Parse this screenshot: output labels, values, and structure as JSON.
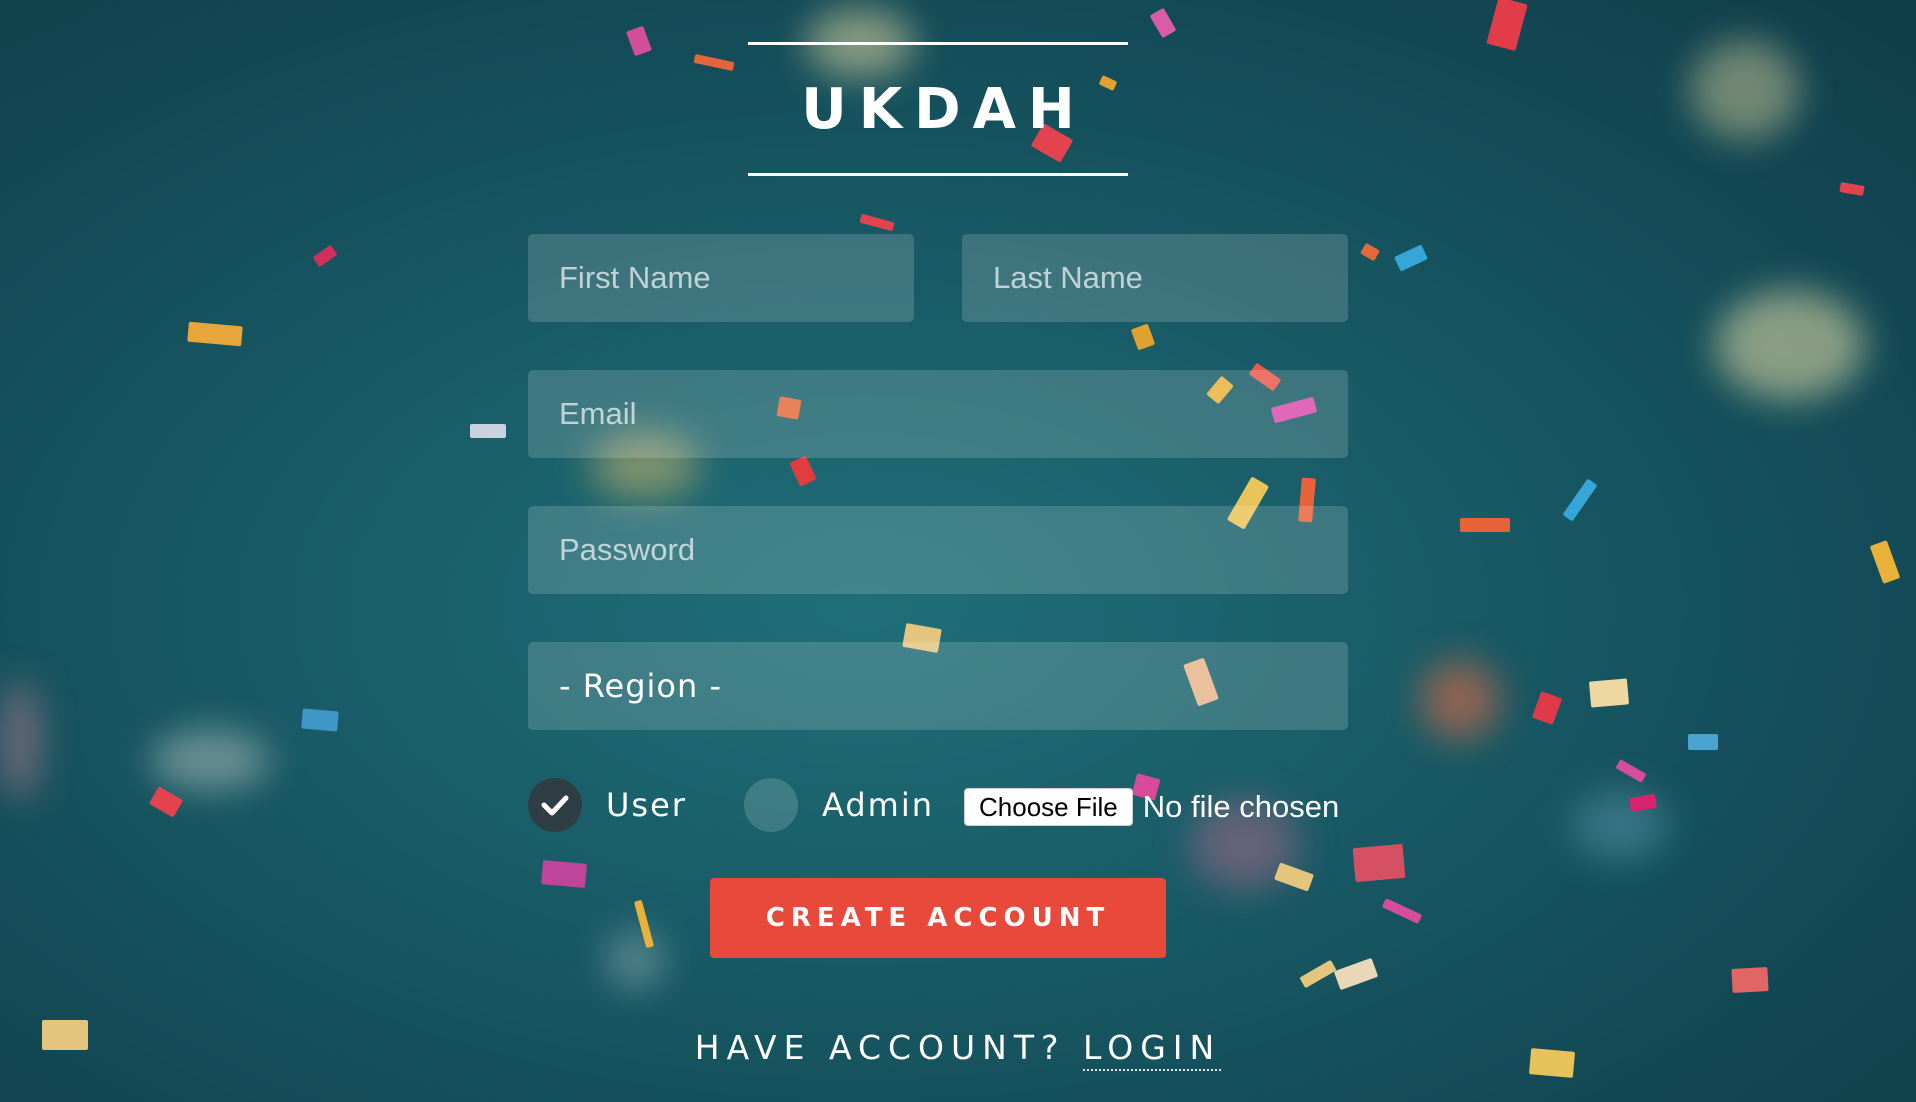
{
  "brand": {
    "title": "UKDAH"
  },
  "form": {
    "first_name": {
      "placeholder": "First Name",
      "value": ""
    },
    "last_name": {
      "placeholder": "Last Name",
      "value": ""
    },
    "email": {
      "placeholder": "Email",
      "value": ""
    },
    "password": {
      "placeholder": "Password",
      "value": ""
    },
    "region": {
      "selected": "- Region -"
    },
    "role": {
      "options": [
        {
          "label": "User",
          "checked": true
        },
        {
          "label": "Admin",
          "checked": false
        }
      ]
    },
    "file": {
      "button_label": "Choose File",
      "status": "No file chosen"
    },
    "submit_label": "CREATE ACCOUNT"
  },
  "footer": {
    "prompt": "HAVE ACCOUNT?",
    "login_label": "LOGIN"
  },
  "colors": {
    "background": "#195d68",
    "accent": "#e9493b",
    "field_bg": "rgba(255,255,255,0.16)",
    "radio_checked": "#2f3d45"
  }
}
